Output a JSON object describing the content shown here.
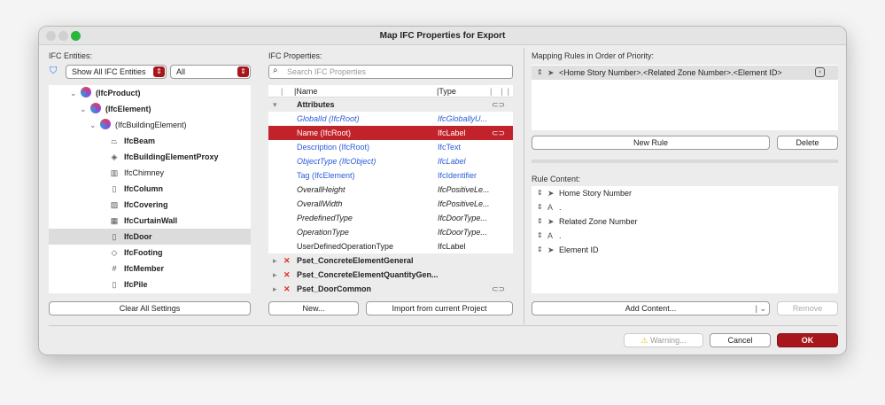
{
  "window": {
    "title": "Map IFC Properties for Export"
  },
  "entities": {
    "label": "IFC Entities:",
    "filter_select": "Show All IFC Entities",
    "type_select": "All",
    "tree": [
      {
        "label": "(IfcProduct)",
        "bold": true
      },
      {
        "label": "(IfcElement)",
        "bold": true
      },
      {
        "label": "(IfcBuildingElement)",
        "bold": false
      },
      {
        "label": "IfcBeam",
        "bold": true,
        "icon": "beam-icon"
      },
      {
        "label": "IfcBuildingElementProxy",
        "bold": true,
        "icon": "proxy-icon"
      },
      {
        "label": "IfcChimney",
        "bold": false,
        "icon": "chimney-icon"
      },
      {
        "label": "IfcColumn",
        "bold": true,
        "icon": "column-icon"
      },
      {
        "label": "IfcCovering",
        "bold": true,
        "icon": "covering-icon"
      },
      {
        "label": "IfcCurtainWall",
        "bold": true,
        "icon": "curtainwall-icon"
      },
      {
        "label": "IfcDoor",
        "bold": true,
        "icon": "door-icon",
        "selected": true
      },
      {
        "label": "IfcFooting",
        "bold": true,
        "icon": "footing-icon"
      },
      {
        "label": "IfcMember",
        "bold": true,
        "icon": "member-icon"
      },
      {
        "label": "IfcPile",
        "bold": true,
        "icon": "pile-icon"
      }
    ],
    "clear_button": "Clear All Settings"
  },
  "properties": {
    "label": "IFC Properties:",
    "search_placeholder": "Search IFC Properties",
    "col_name": "Name",
    "col_type": "Type",
    "group": "Attributes",
    "rows": [
      {
        "name": "GlobalId (IfcRoot)",
        "type": "IfcGloballyU...",
        "style": "blue it"
      },
      {
        "name": "Name (IfcRoot)",
        "type": "IfcLabel",
        "style": "sel",
        "link": true
      },
      {
        "name": "Description (IfcRoot)",
        "type": "IfcText",
        "style": "blue"
      },
      {
        "name": "ObjectType (IfcObject)",
        "type": "IfcLabel",
        "style": "blue it"
      },
      {
        "name": "Tag (IfcElement)",
        "type": "IfcIdentifier",
        "style": "blue"
      },
      {
        "name": "OverallHeight",
        "type": "IfcPositiveLe...",
        "style": "it"
      },
      {
        "name": "OverallWidth",
        "type": "IfcPositiveLe...",
        "style": "it"
      },
      {
        "name": "PredefinedType",
        "type": "IfcDoorType...",
        "style": "it"
      },
      {
        "name": "OperationType",
        "type": "IfcDoorType...",
        "style": "it"
      },
      {
        "name": "UserDefinedOperationType",
        "type": "IfcLabel",
        "style": ""
      }
    ],
    "psets": [
      "Pset_ConcreteElementGeneral",
      "Pset_ConcreteElementQuantityGen...",
      "Pset_DoorCommon"
    ],
    "new_button": "New...",
    "import_button": "Import from current Project"
  },
  "rules": {
    "label": "Mapping Rules in Order of Priority:",
    "items": [
      "<Home Story Number>.<Related Zone Number>.<Element ID>"
    ],
    "new_rule": "New Rule",
    "delete": "Delete"
  },
  "content": {
    "label": "Rule Content:",
    "items": [
      {
        "text": "Home Story Number",
        "kind": "property"
      },
      {
        "text": ".",
        "kind": "text"
      },
      {
        "text": "Related Zone Number",
        "kind": "property"
      },
      {
        "text": ".",
        "kind": "text"
      },
      {
        "text": "Element ID",
        "kind": "property"
      }
    ],
    "add_content": "Add Content...",
    "remove": "Remove"
  },
  "footer": {
    "warning": "Warning...",
    "cancel": "Cancel",
    "ok": "OK"
  },
  "colors": {
    "accent": "#a8161c",
    "selected_row": "#c2232b",
    "link_blue": "#2a5bd8"
  }
}
